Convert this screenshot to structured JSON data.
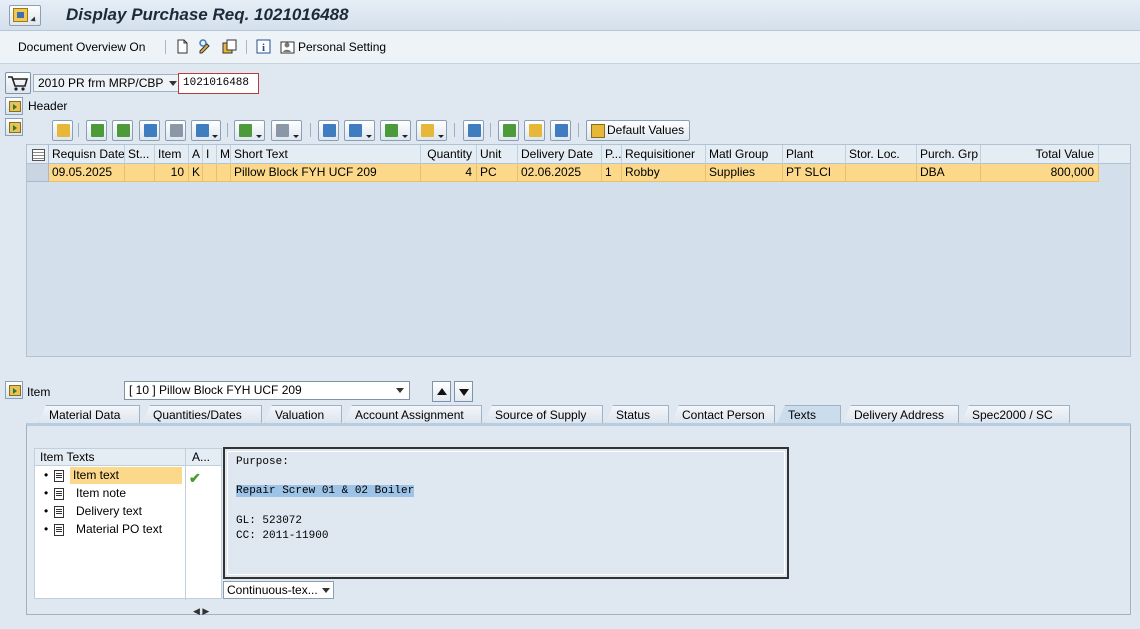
{
  "window": {
    "title": "Display Purchase Req. 1021016488"
  },
  "toolbar": {
    "document_overview": "Document Overview On",
    "personal_setting": "Personal Setting"
  },
  "doc": {
    "type": "2010 PR frm MRP/CBP",
    "number": "1021016488"
  },
  "header_section": {
    "label": "Header"
  },
  "grid_toolbar": {
    "default_values": "Default Values"
  },
  "grid": {
    "columns": [
      "Requisn Date",
      "St...",
      "Item",
      "A",
      "I",
      "Ma",
      "Short Text",
      "Quantity",
      "Unit",
      "Delivery Date",
      "P...",
      "Requisitioner",
      "Matl Group",
      "Plant",
      "Stor. Loc.",
      "Purch. Grp",
      "Total Value"
    ],
    "rows": [
      {
        "requisn_date": "09.05.2025",
        "status": "",
        "item": "10",
        "a": "K",
        "i": "",
        "ma": "",
        "short_text": "Pillow Block FYH UCF 209",
        "quantity": "4",
        "unit": "PC",
        "delivery_date": "02.06.2025",
        "p": "1",
        "requisitioner": "Robby",
        "matl_group": "Supplies",
        "plant": "PT SLCI",
        "stor_loc": "",
        "purch_grp": "DBA",
        "total_value": "800,000"
      }
    ]
  },
  "item_section": {
    "label": "Item",
    "selected": "[ 10 ] Pillow Block FYH UCF 209"
  },
  "tabs": [
    {
      "label": "Material Data",
      "active": false
    },
    {
      "label": "Quantities/Dates",
      "active": false
    },
    {
      "label": "Valuation",
      "active": false
    },
    {
      "label": "Account Assignment",
      "active": false
    },
    {
      "label": "Source of Supply",
      "active": false
    },
    {
      "label": "Status",
      "active": false
    },
    {
      "label": "Contact Person",
      "active": false
    },
    {
      "label": "Texts",
      "active": true
    },
    {
      "label": "Delivery Address",
      "active": false
    },
    {
      "label": "Spec2000 / SC",
      "active": false
    }
  ],
  "texts": {
    "col_item_texts": "Item Texts",
    "col_a": "A...",
    "items": [
      "Item text",
      "Item note",
      "Delivery text",
      "Material PO text"
    ],
    "editor_lines": [
      "Purpose:",
      "",
      "Repair Screw 01 & 02 Boiler",
      "",
      "GL: 523072",
      "CC: 2011-11900"
    ],
    "format": "Continuous-tex..."
  },
  "colors": {
    "selected_row": "#fcd98a",
    "panel_bg": "#dfe8f1",
    "highlight": "#9dc3e6"
  }
}
